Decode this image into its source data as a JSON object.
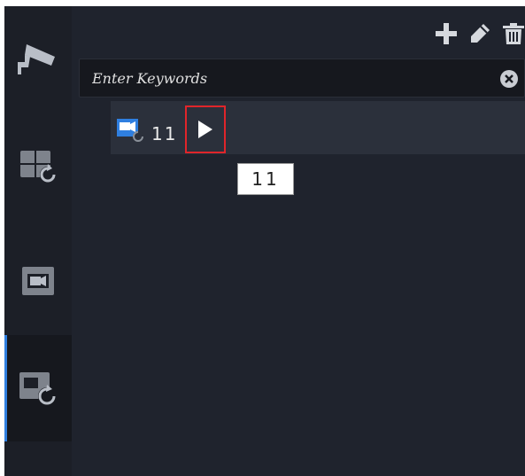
{
  "sidebar": {
    "items": [
      {
        "icon": "camera-icon"
      },
      {
        "icon": "playback-grid-icon"
      },
      {
        "icon": "video-icon"
      },
      {
        "icon": "playback-view-icon",
        "active": true
      }
    ]
  },
  "toolbar": {
    "buttons": [
      {
        "icon": "add-icon"
      },
      {
        "icon": "edit-icon"
      },
      {
        "icon": "delete-icon"
      }
    ]
  },
  "search": {
    "placeholder": "Enter Keywords",
    "value": ""
  },
  "tree": {
    "items": [
      {
        "label": "11",
        "icon": "playback-view-icon"
      }
    ]
  },
  "tooltip": {
    "text": "11"
  },
  "colors": {
    "background": "#1f232d",
    "sidebar": "#1c1f27",
    "accent": "#2f7fe0",
    "highlight_border": "#e0252a"
  }
}
